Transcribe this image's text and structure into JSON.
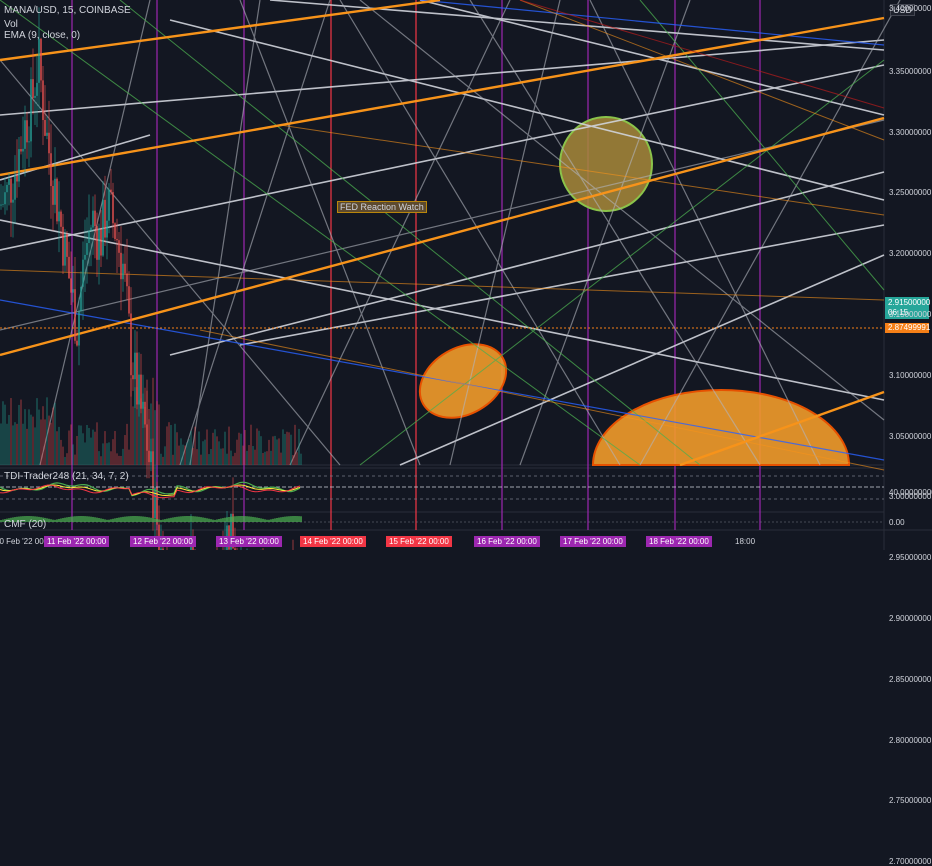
{
  "header": {
    "symbol_line": "MANA/USD, 15, COINBASE",
    "vol_label": "Vol",
    "ema_label": "EMA (9, close, 0)"
  },
  "currency_button": "USD",
  "annotation": "FED Reaction Watch",
  "indicators": {
    "tdi_label": "TDI-Trader248 (21, 34, 7, 2)",
    "cmf_label": "CMF (20)",
    "tdi_tick": "40.00000000",
    "cmf_tick": "0.00"
  },
  "price_tags": {
    "current": "2.91500000",
    "countdown": "06:15",
    "ema": "2.87499991"
  },
  "colors": {
    "background": "#131722",
    "current_price": "#26a69a",
    "ema_tag": "#f57f17",
    "vertical_purple": "#9c27b0",
    "vertical_red": "#f23645",
    "orange_channel": "#f7931a",
    "ellipse_green_fill": "#a98a3a",
    "ellipse_orange_fill": "#f29b2a"
  },
  "chart_data": {
    "type": "candlestick",
    "y_ticks": [
      "3.40000000",
      "3.35000000",
      "3.30000000",
      "3.25000000",
      "3.20000000",
      "3.15000000",
      "3.10000000",
      "3.05000000",
      "3.00000000",
      "2.95000000",
      "2.90000000",
      "2.85000000",
      "2.80000000",
      "2.75000000",
      "2.70000000"
    ],
    "ylim": [
      2.66,
      3.41
    ],
    "x_ticks": [
      {
        "label": "10 Feb '22  00:00",
        "style": "plain"
      },
      {
        "label": "11 Feb '22  00:00",
        "style": "purple"
      },
      {
        "label": "12 Feb '22  00:00",
        "style": "purple"
      },
      {
        "label": "13 Feb '22  00:00",
        "style": "purple"
      },
      {
        "label": "14 Feb '22  00:00",
        "style": "red"
      },
      {
        "label": "15 Feb '22  00:00",
        "style": "red"
      },
      {
        "label": "16 Feb '22  00:00",
        "style": "purple"
      },
      {
        "label": "17 Feb '22  00:00",
        "style": "purple"
      },
      {
        "label": "18 Feb '22  00:00",
        "style": "purple"
      },
      {
        "label": "18:00",
        "style": "plain"
      }
    ],
    "current_price": 2.915,
    "ema_value": 2.87499991,
    "close_path": [
      [
        0,
        3.24
      ],
      [
        3,
        3.25
      ],
      [
        6,
        3.27
      ],
      [
        9,
        3.3
      ],
      [
        12,
        3.32
      ],
      [
        15,
        3.36
      ],
      [
        18,
        3.3
      ],
      [
        21,
        3.26
      ],
      [
        24,
        3.22
      ],
      [
        27,
        3.18
      ],
      [
        30,
        3.14
      ],
      [
        33,
        3.2
      ],
      [
        36,
        3.23
      ],
      [
        39,
        3.21
      ],
      [
        42,
        3.24
      ],
      [
        45,
        3.22
      ],
      [
        48,
        3.19
      ],
      [
        51,
        3.12
      ],
      [
        54,
        3.08
      ],
      [
        57,
        3.05
      ],
      [
        60,
        3.0
      ],
      [
        63,
        2.95
      ],
      [
        66,
        2.92
      ],
      [
        69,
        2.9
      ],
      [
        72,
        2.93
      ],
      [
        75,
        2.95
      ],
      [
        78,
        2.91
      ],
      [
        81,
        2.88
      ],
      [
        84,
        2.92
      ],
      [
        87,
        2.96
      ],
      [
        90,
        2.98
      ],
      [
        93,
        2.94
      ],
      [
        96,
        2.91
      ],
      [
        99,
        2.89
      ],
      [
        102,
        2.92
      ],
      [
        105,
        2.9
      ],
      [
        108,
        2.91
      ],
      [
        111,
        2.92
      ],
      [
        114,
        2.91
      ],
      [
        117,
        2.915
      ]
    ]
  }
}
